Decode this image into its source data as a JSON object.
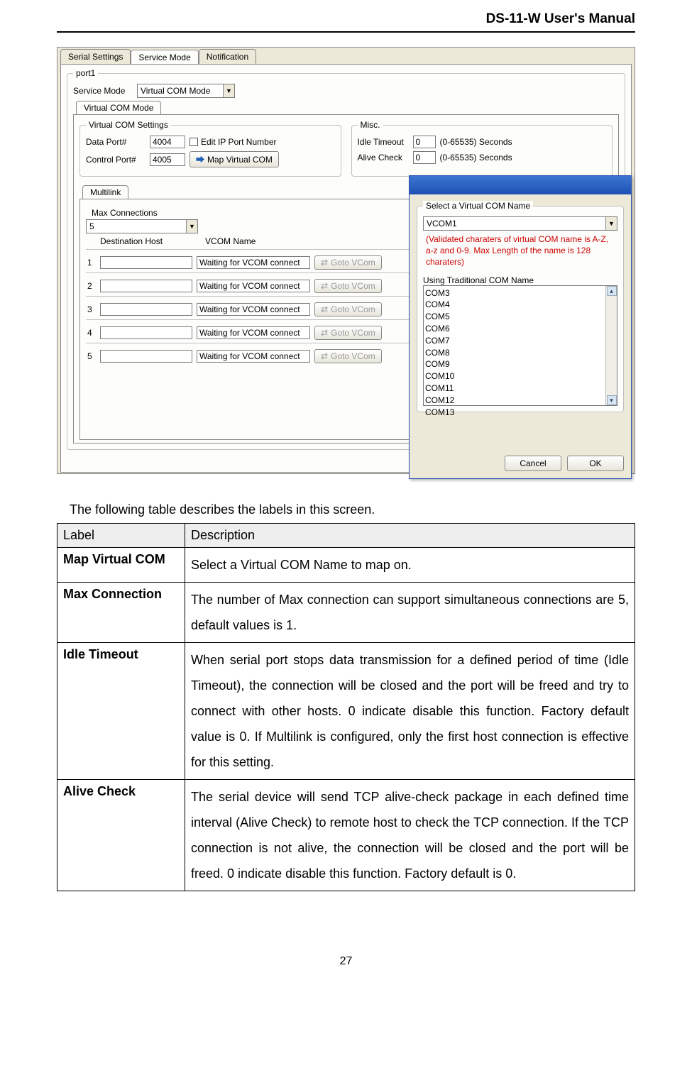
{
  "header": {
    "title": "DS-11-W User's Manual"
  },
  "shot": {
    "tabs": {
      "t1": "Serial Settings",
      "t2": "Service Mode",
      "t3": "Notification"
    },
    "port_group": "port1",
    "service_mode_label": "Service Mode",
    "service_mode_value": "Virtual COM Mode",
    "vcom_tab": "Virtual COM Mode",
    "vcom_group": "Virtual COM Settings",
    "data_port_label": "Data Port#",
    "data_port_value": "4004",
    "control_port_label": "Control Port#",
    "control_port_value": "4005",
    "edit_ip_label": "Edit IP Port Number",
    "map_btn": "Map Virtual COM",
    "misc_group": "Misc.",
    "idle_label": "Idle Timeout",
    "idle_value": "0",
    "idle_hint": "(0-65535) Seconds",
    "alive_label": "Alive Check",
    "alive_value": "0",
    "alive_hint": "(0-65535) Seconds",
    "multilink_tab": "Multilink",
    "maxconn_label": "Max Connections",
    "maxconn_value": "5",
    "col_dest": "Destination Host",
    "col_vcom": "VCOM Name",
    "rows": [
      {
        "n": "1",
        "vtxt": "Waiting for VCOM connect",
        "btn": "Goto VCom"
      },
      {
        "n": "2",
        "vtxt": "Waiting for VCOM connect",
        "btn": "Goto VCom"
      },
      {
        "n": "3",
        "vtxt": "Waiting for VCOM connect",
        "btn": "Goto VCom"
      },
      {
        "n": "4",
        "vtxt": "Waiting for VCOM connect",
        "btn": "Goto VCom"
      },
      {
        "n": "5",
        "vtxt": "Waiting for VCOM connect",
        "btn": "Goto VCom"
      }
    ],
    "dialog": {
      "sel_label": "Select a Virtual COM Name",
      "sel_value": "VCOM1",
      "red_note": "(Validated charaters of virtual COM name is A-Z, a-z and 0-9. Max Length of the name is 128 charaters)",
      "trad_label": "Using Traditional COM Name",
      "coms": [
        "COM3",
        "COM4",
        "COM5",
        "COM6",
        "COM7",
        "COM8",
        "COM9",
        "COM10",
        "COM11",
        "COM12",
        "COM13"
      ],
      "cancel": "Cancel",
      "ok": "OK"
    }
  },
  "intro": "The following table describes the labels in this screen.",
  "table": {
    "h_label": "Label",
    "h_desc": "Description",
    "rows": [
      {
        "label": "Map Virtual COM",
        "desc": "Select a Virtual COM Name to map on."
      },
      {
        "label": "Max Connection",
        "desc": "The number of Max connection can support simultaneous connections are 5, default values is 1."
      },
      {
        "label": "Idle Timeout",
        "desc": "When serial port stops data transmission for a defined period of time (Idle Timeout), the connection will be closed and the port will be freed and try to connect with other hosts.  0 indicate disable this function. Factory default value is 0.  If Multilink is configured, only the first host connection is effective for this setting."
      },
      {
        "label": "Alive Check",
        "desc": "The serial device will send TCP alive-check package in each defined time interval (Alive Check) to remote host to check the TCP connection.  If the TCP connection is not alive, the connection will be closed and the port will be freed.  0 indicate disable this function. Factory default is 0."
      }
    ]
  },
  "pagenum": "27"
}
